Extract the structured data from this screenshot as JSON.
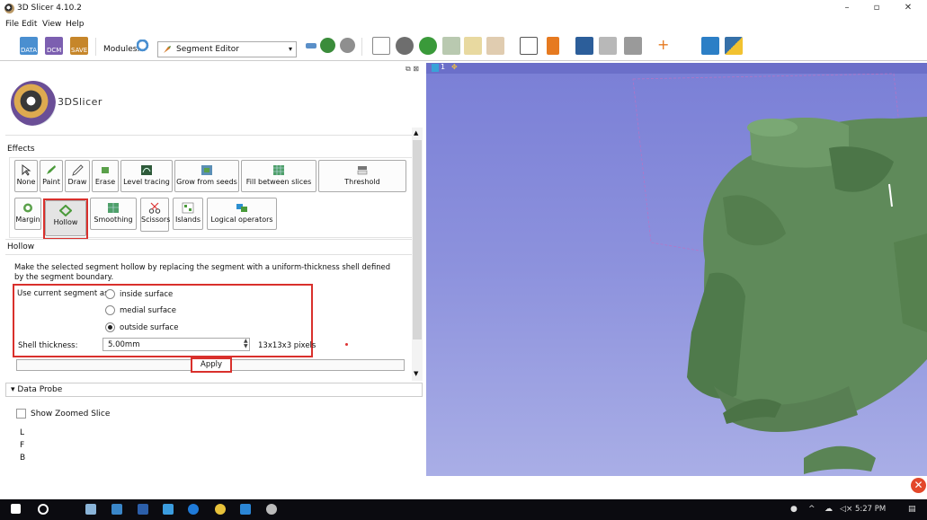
{
  "window": {
    "title": "3D Slicer 4.10.2",
    "controls": [
      "–",
      "▫",
      "✕"
    ]
  },
  "menu": [
    "File",
    "Edit",
    "View",
    "Help"
  ],
  "toolbar": {
    "load_buttons": [
      "DATA",
      "DCM",
      "SAVE"
    ],
    "modules_label": "Modules:",
    "module_selected": "Segment Editor"
  },
  "panel": {
    "logo_text": "3DSlicer",
    "effects_label": "Effects",
    "effects": [
      {
        "label": "None"
      },
      {
        "label": "Paint"
      },
      {
        "label": "Draw"
      },
      {
        "label": "Erase"
      },
      {
        "label": "Level tracing"
      },
      {
        "label": "Grow from seeds"
      },
      {
        "label": "Fill between slices"
      },
      {
        "label": "Threshold"
      },
      {
        "label": "Margin"
      },
      {
        "label": "Hollow"
      },
      {
        "label": "Smoothing"
      },
      {
        "label": "Scissors"
      },
      {
        "label": "Islands"
      },
      {
        "label": "Logical operators"
      }
    ],
    "selected_effect": "Hollow",
    "hollow": {
      "title": "Hollow",
      "description": "Make the selected segment hollow by replacing the segment with a uniform-thickness shell defined by the segment boundary.",
      "use_as_label": "Use current segment as:",
      "options": [
        {
          "label": "inside surface",
          "checked": false
        },
        {
          "label": "medial surface",
          "checked": false
        },
        {
          "label": "outside surface",
          "checked": true
        }
      ],
      "shell_label": "Shell thickness:",
      "shell_value": "5.00mm",
      "pixels": "13x13x3 pixels",
      "apply_label": "Apply"
    },
    "data_probe": {
      "title": "Data Probe",
      "show_zoomed": "Show Zoomed Slice",
      "coords": [
        "L",
        "F",
        "B"
      ]
    }
  },
  "view3d": {
    "number": "1",
    "background": "#8d92dd",
    "model_color": "#5f8a5a"
  },
  "taskbar": {
    "time": "5:27 PM"
  },
  "colors": {
    "highlight": "#d9302c",
    "view_bg": "#7a7fd6",
    "model": "#5f8a5a"
  }
}
